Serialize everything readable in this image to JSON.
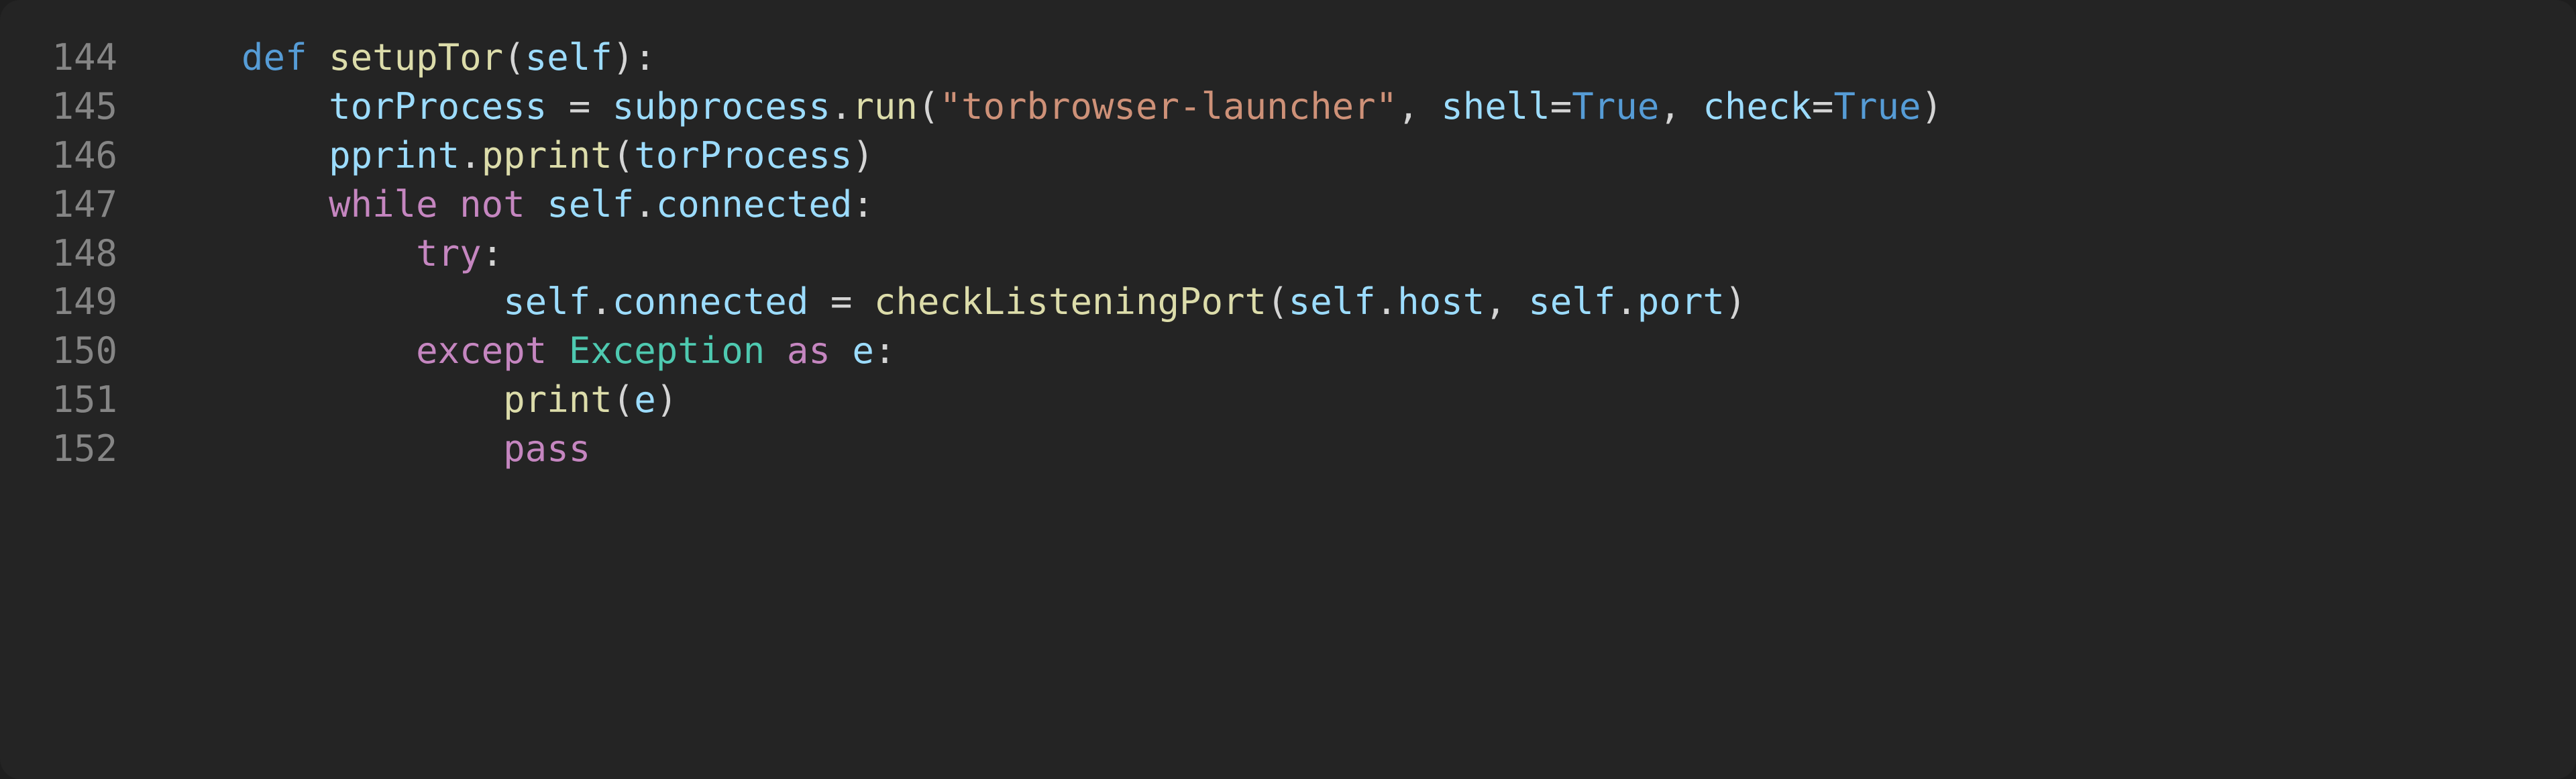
{
  "editor": {
    "lines": [
      {
        "num": "144",
        "indent": "    ",
        "tokens": [
          {
            "t": "def ",
            "c": "kw-def"
          },
          {
            "t": "setupTor",
            "c": "fn-name"
          },
          {
            "t": "(",
            "c": "punct"
          },
          {
            "t": "self",
            "c": "param"
          },
          {
            "t": "):",
            "c": "punct"
          }
        ]
      },
      {
        "num": "145",
        "indent": "        ",
        "tokens": [
          {
            "t": "torProcess ",
            "c": "var"
          },
          {
            "t": "= ",
            "c": "op"
          },
          {
            "t": "subprocess",
            "c": "var"
          },
          {
            "t": ".",
            "c": "punct"
          },
          {
            "t": "run",
            "c": "fn-name"
          },
          {
            "t": "(",
            "c": "punct"
          },
          {
            "t": "\"torbrowser-launcher\"",
            "c": "str"
          },
          {
            "t": ", ",
            "c": "punct"
          },
          {
            "t": "shell",
            "c": "var"
          },
          {
            "t": "=",
            "c": "op"
          },
          {
            "t": "True",
            "c": "const"
          },
          {
            "t": ", ",
            "c": "punct"
          },
          {
            "t": "check",
            "c": "var"
          },
          {
            "t": "=",
            "c": "op"
          },
          {
            "t": "True",
            "c": "const"
          },
          {
            "t": ")",
            "c": "punct"
          }
        ]
      },
      {
        "num": "146",
        "indent": "        ",
        "tokens": [
          {
            "t": "pprint",
            "c": "var"
          },
          {
            "t": ".",
            "c": "punct"
          },
          {
            "t": "pprint",
            "c": "fn-name"
          },
          {
            "t": "(",
            "c": "punct"
          },
          {
            "t": "torProcess",
            "c": "var"
          },
          {
            "t": ")",
            "c": "punct"
          }
        ]
      },
      {
        "num": "147",
        "indent": "        ",
        "tokens": [
          {
            "t": "while ",
            "c": "kw-ctrl"
          },
          {
            "t": "not ",
            "c": "kw-ctrl"
          },
          {
            "t": "self",
            "c": "param"
          },
          {
            "t": ".",
            "c": "punct"
          },
          {
            "t": "connected",
            "c": "var"
          },
          {
            "t": ":",
            "c": "punct"
          }
        ]
      },
      {
        "num": "148",
        "indent": "            ",
        "tokens": [
          {
            "t": "try",
            "c": "kw-ctrl"
          },
          {
            "t": ":",
            "c": "punct"
          }
        ]
      },
      {
        "num": "149",
        "indent": "                ",
        "tokens": [
          {
            "t": "self",
            "c": "param"
          },
          {
            "t": ".",
            "c": "punct"
          },
          {
            "t": "connected ",
            "c": "var"
          },
          {
            "t": "= ",
            "c": "op"
          },
          {
            "t": "checkListeningPort",
            "c": "fn-name"
          },
          {
            "t": "(",
            "c": "punct"
          },
          {
            "t": "self",
            "c": "param"
          },
          {
            "t": ".",
            "c": "punct"
          },
          {
            "t": "host",
            "c": "var"
          },
          {
            "t": ", ",
            "c": "punct"
          },
          {
            "t": "self",
            "c": "param"
          },
          {
            "t": ".",
            "c": "punct"
          },
          {
            "t": "port",
            "c": "var"
          },
          {
            "t": ")",
            "c": "punct"
          }
        ]
      },
      {
        "num": "150",
        "indent": "            ",
        "tokens": [
          {
            "t": "except ",
            "c": "kw-ctrl"
          },
          {
            "t": "Exception ",
            "c": "cls"
          },
          {
            "t": "as ",
            "c": "kw-ctrl"
          },
          {
            "t": "e",
            "c": "var"
          },
          {
            "t": ":",
            "c": "punct"
          }
        ]
      },
      {
        "num": "151",
        "indent": "                ",
        "tokens": [
          {
            "t": "print",
            "c": "fn-name"
          },
          {
            "t": "(",
            "c": "punct"
          },
          {
            "t": "e",
            "c": "var"
          },
          {
            "t": ")",
            "c": "punct"
          }
        ]
      },
      {
        "num": "152",
        "indent": "                ",
        "tokens": [
          {
            "t": "pass",
            "c": "kw-ctrl"
          }
        ]
      }
    ]
  }
}
